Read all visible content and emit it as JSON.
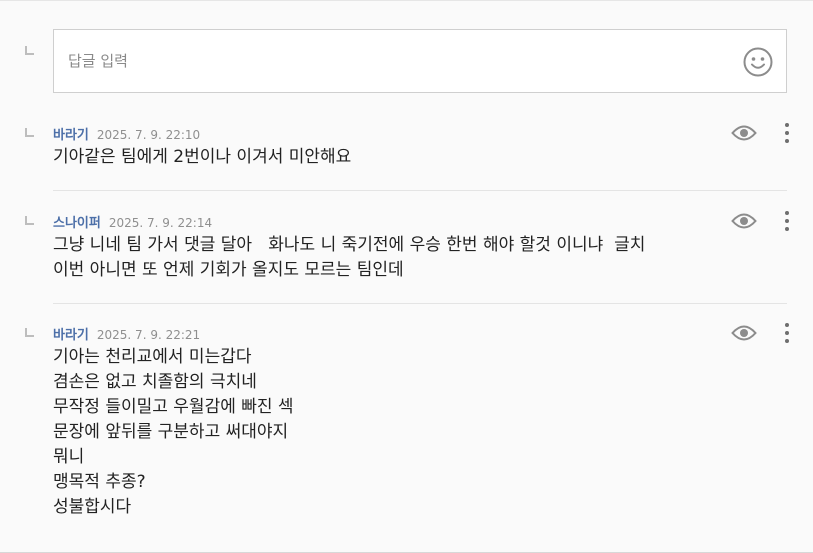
{
  "reply": {
    "placeholder": "답글 입력",
    "value": ""
  },
  "comments": [
    {
      "author": "바라기",
      "date": "2025. 7. 9. 22:10",
      "lines": [
        "기아같은 팀에게 2번이나 이겨서 미안해요"
      ]
    },
    {
      "author": "스나이퍼",
      "date": "2025. 7. 9. 22:14",
      "lines": [
        "그냥 니네 팀 가서 댓글 달아   화나도 니 죽기전에 우승 한번 해야 할것 이니냐  글치",
        "이번 아니면 또 언제 기회가 올지도 모르는 팀인데"
      ]
    },
    {
      "author": "바라기",
      "date": "2025. 7. 9. 22:21",
      "lines": [
        "기아는 천리교에서 미는갑다",
        "겸손은 없고 치졸함의 극치네",
        "무작정 들이밀고 우월감에 빠진 섹",
        "문장에 앞뒤를 구분하고 써대야지",
        "뭐니",
        "맹목적 추종?",
        "성불합시다"
      ]
    }
  ],
  "icons": {
    "reply_indicator": "reply-corner-icon",
    "emoji": "smiley-face-icon",
    "view": "eye-icon",
    "more": "vertical-dots-icon"
  },
  "colors": {
    "author": "#4c6fa8",
    "date": "#8f8f8f",
    "icon": "#8c8c8c",
    "text": "#222222"
  }
}
